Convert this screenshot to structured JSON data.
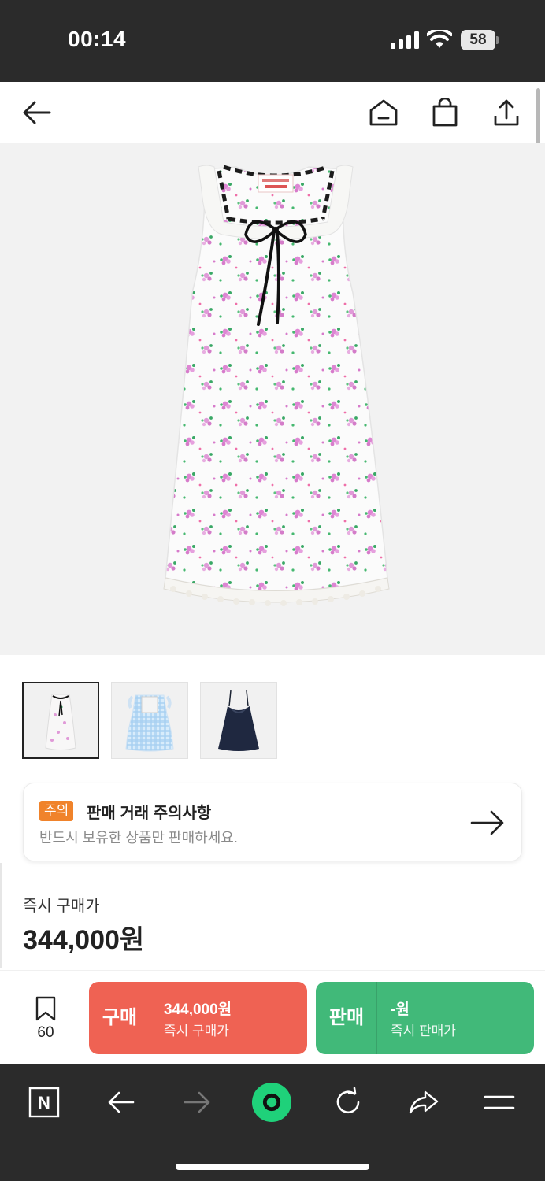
{
  "status_bar": {
    "time": "00:14",
    "battery": "58"
  },
  "app_bar": {
    "back_icon": "arrow-left-icon",
    "home_icon": "home-icon",
    "bag_icon": "shopping-bag-icon",
    "share_icon": "share-icon"
  },
  "product": {
    "thumbnails": [
      {
        "name": "floral-sleeveless-dress"
      },
      {
        "name": "blue-gingham-dress"
      },
      {
        "name": "navy-slip-dress"
      }
    ]
  },
  "notice": {
    "badge": "주의",
    "title": "판매 거래 주의사항",
    "subtitle": "반드시 보유한 상품만 판매하세요."
  },
  "price": {
    "label": "즉시 구매가",
    "value": "344,000원"
  },
  "action_bar": {
    "bookmark_count": "60",
    "buy": {
      "label": "구매",
      "price": "344,000원",
      "sub": "즉시 구매가"
    },
    "sell": {
      "label": "판매",
      "price": "-원",
      "sub": "즉시 판매가"
    }
  },
  "browser": {
    "n_icon_label": "N"
  },
  "colors": {
    "buy": "#ef6253",
    "sell": "#41b979",
    "badge": "#f0832b",
    "browser_accent": "#1fd17a"
  }
}
